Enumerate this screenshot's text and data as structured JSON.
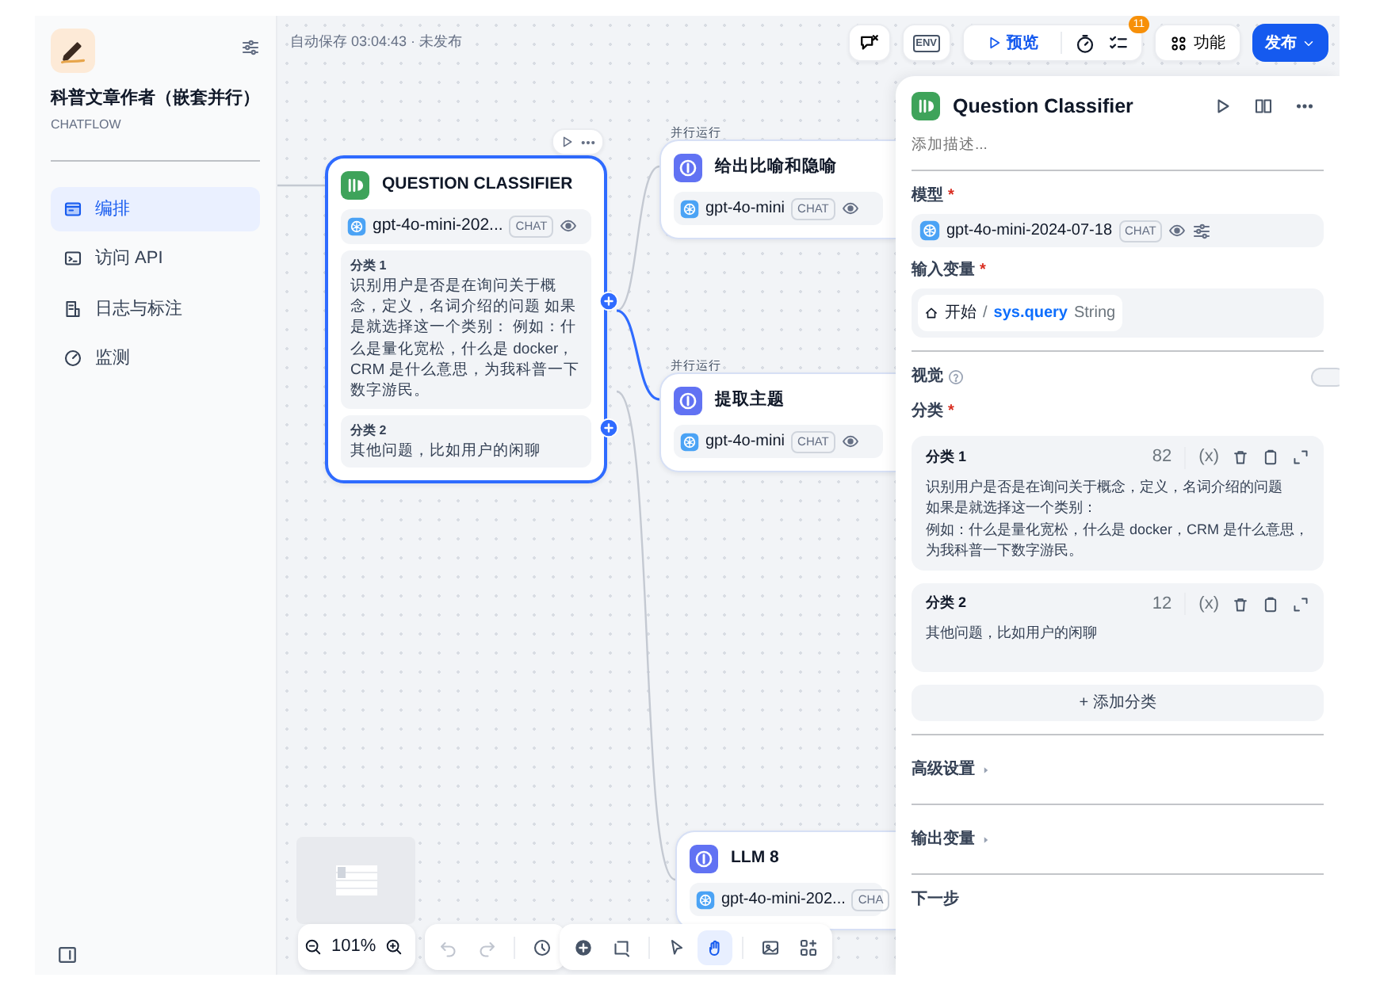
{
  "app": {
    "title": "科普文章作者（嵌套并行）",
    "type": "CHATFLOW"
  },
  "nav": [
    {
      "label": "编排",
      "selected": true
    },
    {
      "label": "访问 API",
      "selected": false
    },
    {
      "label": "日志与标注",
      "selected": false
    },
    {
      "label": "监测",
      "selected": false
    }
  ],
  "autosave": "自动保存 03:04:43 · 未发布",
  "toolbar": {
    "env": "ENV",
    "preview": "预览",
    "badge": "11",
    "features": "功能",
    "publish": "发布"
  },
  "nodes": [
    {
      "kind": "classifier",
      "selected": true,
      "title": "QUESTION CLASSIFIER",
      "model": "gpt-4o-mini-202...",
      "tag": "CHAT",
      "classes": [
        {
          "name": "分类 1",
          "text": "识别用户是否是在询问关于概念，定义，名词介绍的问题 如果是就选择这一个类别： 例如：什么是量化宽松，什么是 docker，CRM 是什么意思，为我科普一下数字游民。"
        },
        {
          "name": "分类 2",
          "text": "其他问题，比如用户的闲聊"
        }
      ]
    },
    {
      "kind": "llm",
      "selected": false,
      "label": "并行运行",
      "title": "给出比喻和隐喻",
      "model": "gpt-4o-mini",
      "tag": "CHAT"
    },
    {
      "kind": "llm",
      "selected": false,
      "label": "并行运行",
      "title": "提取主题",
      "model": "gpt-4o-mini",
      "tag": "CHAT"
    },
    {
      "kind": "llm",
      "selected": false,
      "title": "LLM 8",
      "model": "gpt-4o-mini-202...",
      "tag": "CHA"
    }
  ],
  "zoom_level": "101%",
  "history_tools": [
    {
      "disabled": true
    },
    {
      "disabled": true
    },
    {
      "disabled": false
    }
  ],
  "canvas_tools": [
    {
      "selected": false
    },
    {
      "selected": false
    },
    {
      "selected": false
    },
    {
      "selected": true
    },
    {
      "selected": false
    },
    {
      "selected": false
    }
  ],
  "panel": {
    "title": "Question Classifier",
    "description_placeholder": "添加描述...",
    "model_label": "模型",
    "model_required": "*",
    "model": "gpt-4o-mini-2024-07-18",
    "model_tag": "CHAT",
    "input_label": "输入变量",
    "input_required": "*",
    "input_node": "开始",
    "input_sep": "/",
    "input_var": "sys.query",
    "input_type": "String",
    "vision_label": "视觉",
    "vision_on": false,
    "classes_label": "分类",
    "classes_required": "*",
    "classes": [
      {
        "name": "分类 1",
        "count": "82",
        "insert_var": "(x)",
        "lines": [
          "识别用户是否是在询问关于概念，定义，名词介绍的问题",
          "如果是就选择这一个类别：",
          "例如：什么是量化宽松，什么是 docker，CRM 是什么意思，为我科普一下数字游民。"
        ]
      },
      {
        "name": "分类 2",
        "count": "12",
        "insert_var": "(x)",
        "lines": [
          "其他问题，比如用户的闲聊"
        ]
      }
    ],
    "add_class": "+ 添加分类",
    "sections": [
      {
        "label": "高级设置",
        "expanded": false
      },
      {
        "label": "输出变量",
        "expanded": false
      }
    ],
    "next_label": "下一步"
  }
}
